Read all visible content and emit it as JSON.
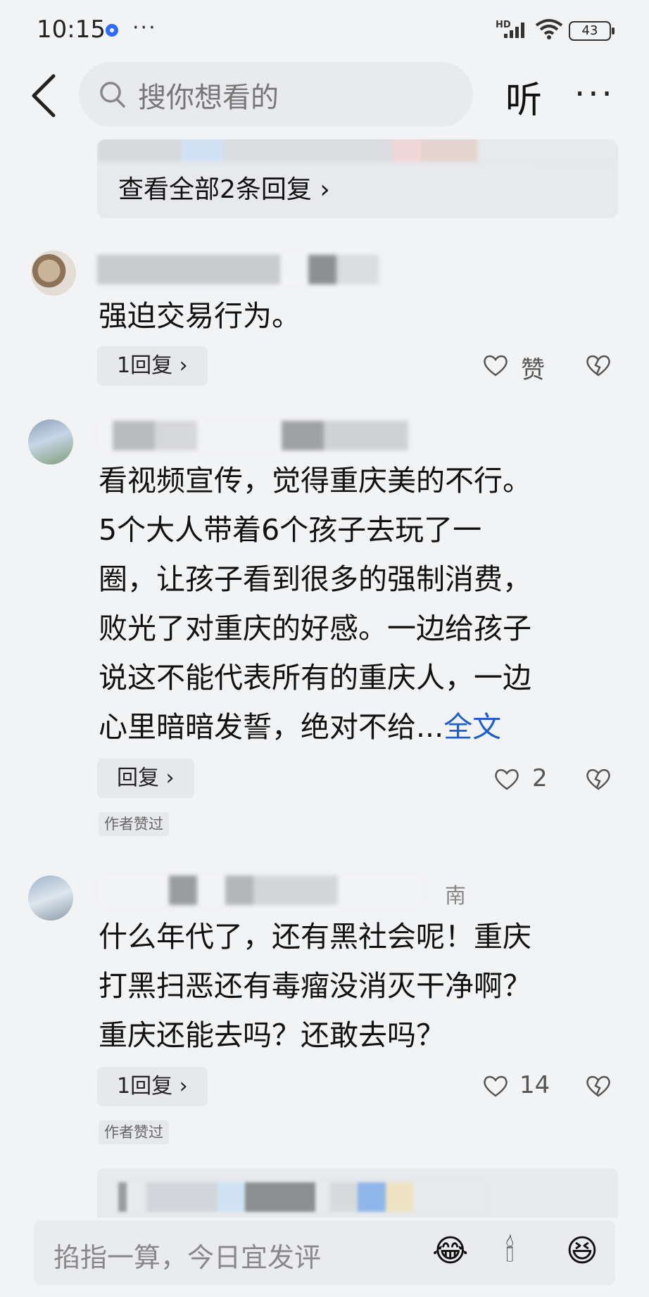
{
  "status_bar": {
    "time": "10:15",
    "more": "···",
    "net": "HD",
    "battery": "43"
  },
  "header": {
    "search_placeholder": "搜你想看的",
    "listen_label": "听",
    "more_label": "···"
  },
  "top_reply_card": {
    "view_all": "查看全部2条回复 ›"
  },
  "comments": [
    {
      "text": "强迫交易行为。",
      "reply_label": "1回复 ›",
      "like_label": "赞",
      "author_liked": ""
    },
    {
      "text_lines": [
        "看视频宣传，觉得重庆美的不行。",
        "5个大人带着6个孩子去玩了一",
        "圈，让孩子看到很多的强制消费，",
        "败光了对重庆的好感。一边给孩子",
        "说这不能代表所有的重庆人，一边",
        "心里暗暗发誓，绝对不给..."
      ],
      "full_text_link": "全文",
      "reply_label": "回复 ›",
      "like_count": "2",
      "author_liked": "作者赞过"
    },
    {
      "name_suffix": "南",
      "text_lines": [
        "什么年代了，还有黑社会呢！重庆",
        "打黑扫恶还有毒瘤没消灭干净啊？",
        "重庆还能去吗？还敢去吗？"
      ],
      "reply_label": "1回复 ›",
      "like_count": "14",
      "author_liked": "作者赞过"
    }
  ],
  "input_bar": {
    "placeholder": "掐指一算，今日宜发评",
    "emojis": [
      "😂",
      "🕯",
      "😆"
    ]
  },
  "colors": {
    "link": "#1f5fc8",
    "background": "#f2f3f5",
    "pill": "#e6e8eb"
  }
}
